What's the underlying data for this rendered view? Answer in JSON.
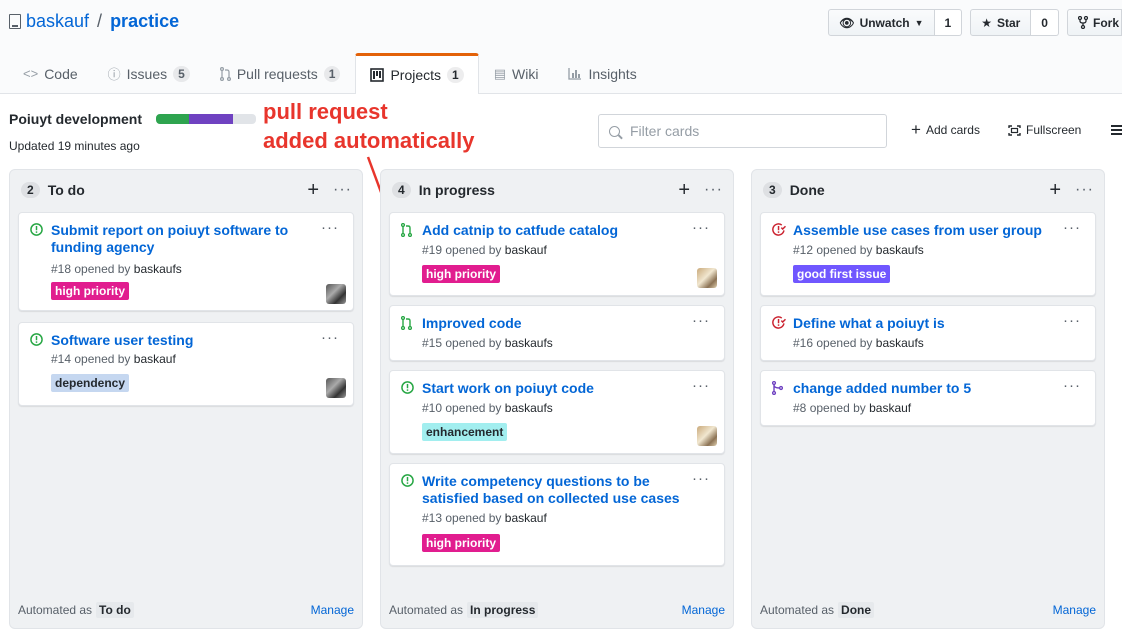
{
  "repo": {
    "owner": "baskauf",
    "separator": "/",
    "name": "practice"
  },
  "actions": {
    "watch": {
      "label": "Unwatch",
      "count": "1"
    },
    "star": {
      "label": "Star",
      "count": "0"
    },
    "fork": {
      "label": "Fork"
    }
  },
  "tabs": [
    {
      "label": "Code",
      "counter": null
    },
    {
      "label": "Issues",
      "counter": "5"
    },
    {
      "label": "Pull requests",
      "counter": "1"
    },
    {
      "label": "Projects",
      "counter": "1",
      "selected": true
    },
    {
      "label": "Wiki",
      "counter": null
    },
    {
      "label": "Insights",
      "counter": null
    }
  ],
  "project": {
    "name": "Poiuyt development",
    "updated": "Updated 19 minutes ago",
    "progress": {
      "done_pct": 33,
      "in_progress_pct": 44,
      "todo_pct": 23
    }
  },
  "annotation": {
    "line1": "pull request",
    "line2": "added automatically",
    "color": "#e8352c"
  },
  "filter": {
    "placeholder": "Filter cards"
  },
  "header_links": {
    "add_cards": "Add cards",
    "fullscreen": "Fullscreen"
  },
  "columns": [
    {
      "count": "2",
      "name": "To do",
      "footer": {
        "automated_as": "Automated as",
        "value": "To do",
        "manage": "Manage"
      },
      "cards": [
        {
          "type": "issue-open",
          "title": "Submit report on poiuyt software to funding agency",
          "number": "#18",
          "opened_by": "opened by",
          "user": "baskaufs",
          "label": {
            "text": "high priority",
            "color": "#e11d8f"
          },
          "avatar": true
        },
        {
          "type": "issue-open",
          "title": "Software user testing",
          "number": "#14",
          "opened_by": "opened by",
          "user": "baskauf",
          "label": {
            "text": "dependency",
            "color": "#c5d7f0"
          },
          "avatar": true
        }
      ]
    },
    {
      "count": "4",
      "name": "In progress",
      "footer": {
        "automated_as": "Automated as",
        "value": "In progress",
        "manage": "Manage"
      },
      "cards": [
        {
          "type": "pr-open",
          "title": "Add catnip to catfude catalog",
          "number": "#19",
          "opened_by": "opened by",
          "user": "baskauf",
          "label": {
            "text": "high priority",
            "color": "#e11d8f"
          },
          "avatar": true
        },
        {
          "type": "pr-open",
          "title": "Improved code",
          "number": "#15",
          "opened_by": "opened by",
          "user": "baskaufs",
          "label": null,
          "avatar": false
        },
        {
          "type": "issue-open",
          "title": "Start work on poiuyt code",
          "number": "#10",
          "opened_by": "opened by",
          "user": "baskaufs",
          "label": {
            "text": "enhancement",
            "color": "#a2eeef"
          },
          "avatar": true
        },
        {
          "type": "issue-open",
          "title": "Write competency questions to be satisfied based on collected use cases",
          "number": "#13",
          "opened_by": "opened by",
          "user": "baskauf",
          "label": {
            "text": "high priority",
            "color": "#e11d8f"
          },
          "avatar": false
        }
      ]
    },
    {
      "count": "3",
      "name": "Done",
      "footer": {
        "automated_as": "Automated as",
        "value": "Done",
        "manage": "Manage"
      },
      "cards": [
        {
          "type": "issue-closed",
          "title": "Assemble use cases from user group",
          "number": "#12",
          "opened_by": "opened by",
          "user": "baskaufs",
          "label": {
            "text": "good first issue",
            "color": "#7057ff"
          },
          "avatar": false
        },
        {
          "type": "issue-closed",
          "title": "Define what a poiuyt is",
          "number": "#16",
          "opened_by": "opened by",
          "user": "baskaufs",
          "label": null,
          "avatar": false
        },
        {
          "type": "pr-merged",
          "title": "change added number to 5",
          "number": "#8",
          "opened_by": "opened by",
          "user": "baskauf",
          "label": null,
          "avatar": false
        }
      ]
    }
  ],
  "colors": {
    "link": "#0366d6",
    "open": "#28a745",
    "closed": "#cb2431",
    "merged": "#6f42c1",
    "tab_accent": "#e36209"
  }
}
